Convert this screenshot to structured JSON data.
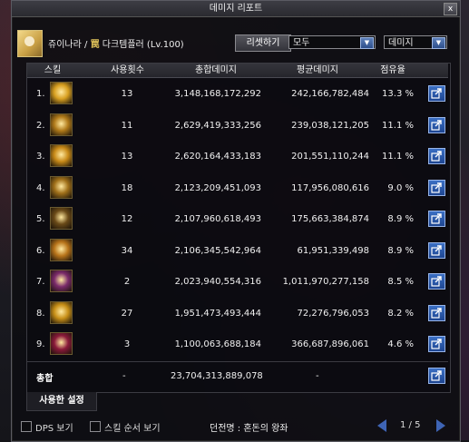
{
  "window": {
    "title": "데미지 리포트",
    "close": "x"
  },
  "character": {
    "name": "쥬이나라",
    "separator": "/",
    "job_glyph": "罠",
    "class_level": "다크템플러 (Lv.100)"
  },
  "controls": {
    "reset_label": "리셋하기",
    "filter_select": "모두",
    "sort_select": "데미지"
  },
  "table": {
    "headers": {
      "skill": "스킬",
      "uses": "사용횟수",
      "total": "총합데미지",
      "avg": "평균데미지",
      "share": "점유율"
    },
    "rows": [
      {
        "rank": "1.",
        "uses": "13",
        "total": "3,148,168,172,292",
        "avg": "242,166,782,484",
        "pct": "13.3 %",
        "icon_color": "#d8a021"
      },
      {
        "rank": "2.",
        "uses": "11",
        "total": "2,629,419,333,256",
        "avg": "239,038,121,205",
        "pct": "11.1 %",
        "icon_color": "#b07a1a"
      },
      {
        "rank": "3.",
        "uses": "13",
        "total": "2,620,164,433,183",
        "avg": "201,551,110,244",
        "pct": "11.1 %",
        "icon_color": "#c88a18"
      },
      {
        "rank": "4.",
        "uses": "18",
        "total": "2,123,209,451,093",
        "avg": "117,956,080,616",
        "pct": "9.0 %",
        "icon_color": "#a0701a"
      },
      {
        "rank": "5.",
        "uses": "12",
        "total": "2,107,960,618,493",
        "avg": "175,663,384,874",
        "pct": "8.9 %",
        "icon_color": "#6a4a18"
      },
      {
        "rank": "6.",
        "uses": "34",
        "total": "2,106,345,542,964",
        "avg": "61,951,339,498",
        "pct": "8.9 %",
        "icon_color": "#b8741a"
      },
      {
        "rank": "7.",
        "uses": "2",
        "total": "2,023,940,554,316",
        "avg": "1,011,970,277,158",
        "pct": "8.5 %",
        "icon_color": "#7a2a6a"
      },
      {
        "rank": "8.",
        "uses": "27",
        "total": "1,951,473,493,444",
        "avg": "72,276,796,053",
        "pct": "8.2 %",
        "icon_color": "#c89018"
      },
      {
        "rank": "9.",
        "uses": "3",
        "total": "1,100,063,688,184",
        "avg": "366,687,896,061",
        "pct": "4.6 %",
        "icon_color": "#8a1a3a"
      }
    ],
    "total": {
      "label": "총합",
      "uses": "-",
      "total": "23,704,313,889,078",
      "avg": "-"
    }
  },
  "tabs": {
    "used_settings": "사용한 설정"
  },
  "bottom": {
    "dps_label": "DPS 보기",
    "skill_order_label": "스킬 순서 보기",
    "dungeon": "던전명 : 혼돈의 왕좌",
    "page": "1 / 5"
  },
  "colors": {
    "accent_blue": "#3b6fc4",
    "icon_border": "#6a5a30"
  }
}
